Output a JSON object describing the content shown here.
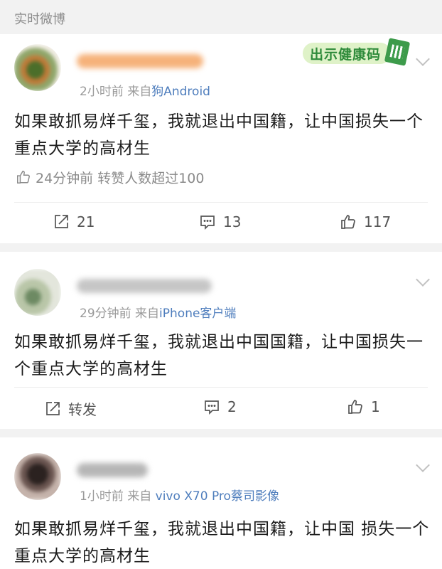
{
  "section": {
    "title": "实时微博"
  },
  "badge": {
    "text": "出示健康码"
  },
  "posts": [
    {
      "meta_time": "2小时前",
      "meta_from": "来自",
      "meta_source": "狗Android",
      "text": "如果敢抓易烊千玺，我就退出中国籍，让中国损失一个重点大学的高材生",
      "like_info": "24分钟前 转赞人数超过100",
      "forward": "21",
      "comments": "13",
      "likes": "117"
    },
    {
      "meta_time": "29分钟前",
      "meta_from": "来自",
      "meta_source": "iPhone客户端",
      "text": "如果敢抓易烊千玺，我就退出中国国籍，让中国损失一个重点大学的高材生",
      "forward": "转发",
      "comments": "2",
      "likes": "1"
    },
    {
      "meta_time": "1小时前",
      "meta_from": "来自",
      "meta_source": "vivo X70 Pro蔡司影像",
      "text": "如果敢抓易烊千玺，我就退出中国籍，让中国 损失一个重点大学的高材生"
    }
  ]
}
